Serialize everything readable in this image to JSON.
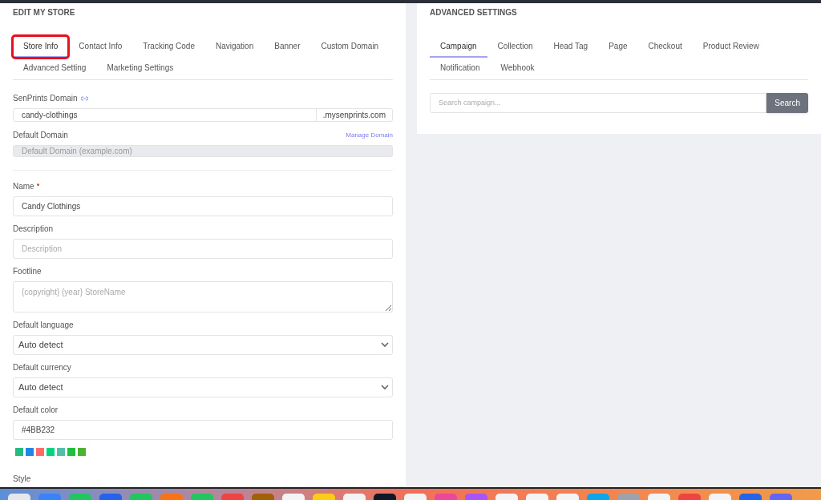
{
  "store_panel": {
    "title": "EDIT MY STORE",
    "tabs": [
      {
        "label": "Store Info",
        "selected": true,
        "highlighted": true
      },
      {
        "label": "Contact Info",
        "selected": false,
        "highlighted": false
      },
      {
        "label": "Tracking Code",
        "selected": false,
        "highlighted": false
      },
      {
        "label": "Navigation",
        "selected": false,
        "highlighted": false
      },
      {
        "label": "Banner",
        "selected": false,
        "highlighted": false
      },
      {
        "label": "Custom Domain",
        "selected": false,
        "highlighted": false
      },
      {
        "label": "Advanced Setting",
        "selected": false,
        "highlighted": false
      },
      {
        "label": "Marketing Settings",
        "selected": false,
        "highlighted": false
      }
    ],
    "senprints_domain": {
      "label": "SenPrints Domain",
      "value": "candy-clothings",
      "suffix": ".mysenprints.com"
    },
    "default_domain": {
      "label": "Default Domain",
      "link": "Manage Domain",
      "placeholder": "Default Domain (example.com)",
      "disabled": true
    },
    "fields": [
      {
        "kind": "input",
        "label": "Name",
        "required": true,
        "value": "Candy Clothings"
      },
      {
        "kind": "input",
        "label": "Description",
        "required": false,
        "placeholder": "Description"
      },
      {
        "kind": "textarea",
        "label": "Footline",
        "required": false,
        "placeholder": "{copyright} {year} StoreName"
      },
      {
        "kind": "select",
        "label": "Default language",
        "required": false,
        "value": "Auto detect"
      },
      {
        "kind": "select",
        "label": "Default currency",
        "required": false,
        "value": "Auto detect"
      },
      {
        "kind": "input",
        "label": "Default color",
        "required": false,
        "value": "#4BB232"
      }
    ],
    "swatches": [
      {
        "color": "#25bb7e"
      },
      {
        "color": "#1e88e5"
      },
      {
        "color": "#ff6b6b"
      },
      {
        "color": "#00d67f"
      },
      {
        "color": "#52bfa8"
      },
      {
        "color": "#1fbf3f"
      },
      {
        "color": "#4bb232"
      }
    ],
    "next_label": "Style"
  },
  "advanced_panel": {
    "title": "ADVANCED SETTINGS",
    "tabs": [
      {
        "label": "Campaign",
        "selected": true
      },
      {
        "label": "Collection",
        "selected": false
      },
      {
        "label": "Head Tag",
        "selected": false
      },
      {
        "label": "Page",
        "selected": false
      },
      {
        "label": "Checkout",
        "selected": false
      },
      {
        "label": "Product Review",
        "selected": false
      },
      {
        "label": "Notification",
        "selected": false
      },
      {
        "label": "Webhook",
        "selected": false
      }
    ],
    "search": {
      "placeholder": "Search campaign...",
      "button": "Search"
    }
  }
}
